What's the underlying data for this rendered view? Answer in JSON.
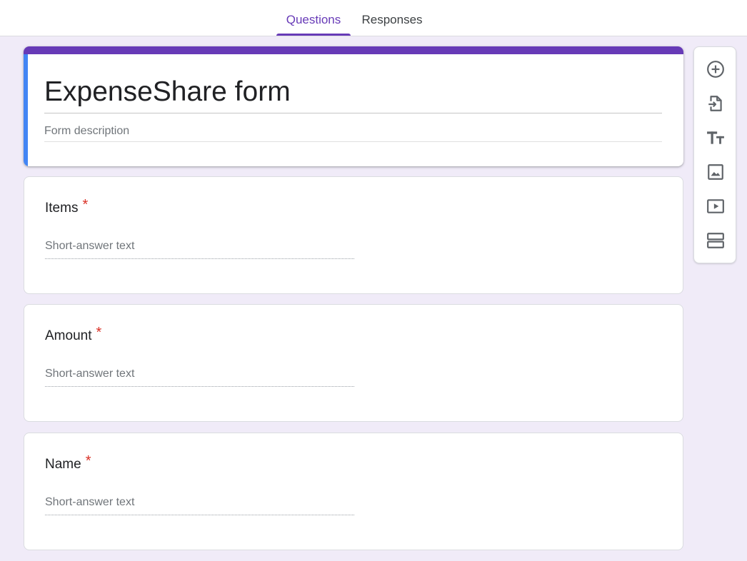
{
  "tabs": {
    "questions": "Questions",
    "responses": "Responses",
    "active": "questions"
  },
  "form": {
    "title": "ExpenseShare form",
    "description_placeholder": "Form description"
  },
  "questions": [
    {
      "title": "Items",
      "required_marker": "*",
      "answer_placeholder": "Short-answer text"
    },
    {
      "title": "Amount",
      "required_marker": "*",
      "answer_placeholder": "Short-answer text"
    },
    {
      "title": "Name",
      "required_marker": "*",
      "answer_placeholder": "Short-answer text"
    }
  ],
  "toolbar": {
    "icons": [
      "add-question-icon",
      "import-questions-icon",
      "add-title-icon",
      "add-image-icon",
      "add-video-icon",
      "add-section-icon"
    ]
  },
  "colors": {
    "accent": "#673ab7",
    "header_stripe": "#4285f4",
    "required": "#d93025",
    "background": "#f0ebf8"
  }
}
